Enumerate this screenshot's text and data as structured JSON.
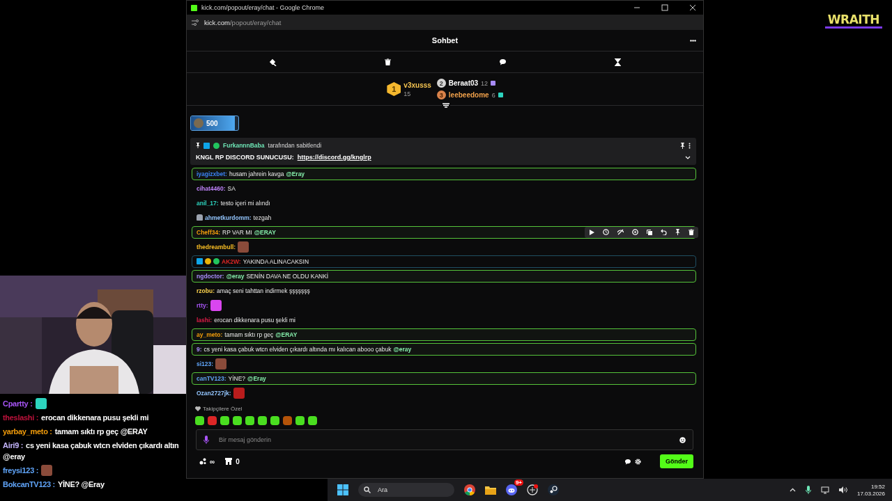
{
  "logo": {
    "text": "WRAITH"
  },
  "browser": {
    "title": "kick.com/popout/eray/chat - Google Chrome",
    "url_host": "kick.com",
    "url_path": "/popout/eray/chat"
  },
  "chat_header": {
    "title": "Sohbet"
  },
  "leaderboard": [
    {
      "rank": "1",
      "name": "v3xusss",
      "count": "15",
      "color": "#f5c451"
    },
    {
      "rank": "2",
      "name": "Beraat03",
      "count": "12",
      "color": "#ffffff"
    },
    {
      "rank": "3",
      "name": "leebeedome",
      "count": "6",
      "color": "#f0a14b"
    }
  ],
  "goal": {
    "amount": "500",
    "level": 0.93
  },
  "pinned": {
    "user": "FurkannnBaba",
    "note": "tarafından sabitlendi",
    "text": "KNGL RP DISCORD SUNUCUSU:",
    "link": "https://discord.gg/knglrp"
  },
  "messages": [
    {
      "kind": "mention",
      "user": "iyagizxbet:",
      "color": "#3b82f6",
      "parts": [
        {
          "kind": "text",
          "text": "husam jahrein kavga"
        },
        {
          "kind": "mention",
          "text": "@Eray"
        }
      ]
    },
    {
      "kind": "plain",
      "user": "cihat4460:",
      "color": "#c084fc",
      "parts": [
        {
          "kind": "text",
          "text": "SA"
        }
      ]
    },
    {
      "kind": "plain",
      "user": "anil_17:",
      "color": "#2dd4bf",
      "parts": [
        {
          "kind": "text",
          "text": "testo içeri mi alındı"
        }
      ]
    },
    {
      "kind": "plain",
      "user": "ahmetkurdomm:",
      "color": "#93c5fd",
      "badges": [
        {
          "kind": "helmet"
        }
      ],
      "parts": [
        {
          "kind": "text",
          "text": "tezgah"
        }
      ]
    },
    {
      "kind": "mention",
      "user": "Cheff34:",
      "color": "#f59e0b",
      "hovered": true,
      "parts": [
        {
          "kind": "text",
          "text": "RP VAR MI"
        },
        {
          "kind": "mention",
          "text": "@ERAY"
        }
      ]
    },
    {
      "kind": "plain",
      "user": "thedreambull:",
      "color": "#fbbf24",
      "parts": [
        {
          "kind": "emote",
          "color": "#8a4b3a"
        }
      ]
    },
    {
      "kind": "moderator",
      "user": "AK2W:",
      "color": "#dc2626",
      "badges": [
        {
          "kind": "moderator"
        },
        {
          "kind": "subscriber"
        },
        {
          "kind": "gifter"
        }
      ],
      "parts": [
        {
          "kind": "text",
          "text": "YAKINDA ALINACAKSIN"
        }
      ]
    },
    {
      "kind": "mention",
      "user": "ngdoctor:",
      "color": "#a78bfa",
      "parts": [
        {
          "kind": "mention",
          "text": "@eray"
        },
        {
          "kind": "text",
          "text": "SENİN DAVA NE OLDU KANKİ"
        }
      ]
    },
    {
      "kind": "plain",
      "user": "rzobu:",
      "color": "#fcd34d",
      "parts": [
        {
          "kind": "text",
          "text": "amaç seni tahttan indirmek şşşşşşş"
        }
      ]
    },
    {
      "kind": "plain",
      "user": "rtty:",
      "color": "#a855f7",
      "parts": [
        {
          "kind": "emote",
          "color": "#d946ef"
        }
      ]
    },
    {
      "kind": "plain",
      "user": "lashi:",
      "color": "#e11d48",
      "parts": [
        {
          "kind": "text",
          "text": "erocan dikkenara pusu şekli mi"
        }
      ]
    },
    {
      "kind": "mention",
      "user": "ay_meto:",
      "color": "#f59e0b",
      "parts": [
        {
          "kind": "text",
          "text": "tamam sıktı rp geç"
        },
        {
          "kind": "mention",
          "text": "@ERAY"
        }
      ]
    },
    {
      "kind": "mention",
      "user": "9:",
      "color": "#a78bfa",
      "parts": [
        {
          "kind": "text",
          "text": "cs yeni kasa çabuk wtcn elviden çıkardı altında mı kalıcan abooo çabuk"
        },
        {
          "kind": "mention",
          "text": "@eray"
        }
      ]
    },
    {
      "kind": "plain",
      "user": "si123:",
      "color": "#60a5fa",
      "parts": [
        {
          "kind": "emote",
          "color": "#8a4b3a"
        }
      ]
    },
    {
      "kind": "mention",
      "user": "canTV123:",
      "color": "#60a5fa",
      "parts": [
        {
          "kind": "text",
          "text": "YİNE?"
        },
        {
          "kind": "mention",
          "text": "@Eray"
        }
      ]
    },
    {
      "kind": "plain",
      "user": "Ozan2727jk:",
      "color": "#93c5fd",
      "parts": [
        {
          "kind": "emote",
          "color": "#b91c1c"
        }
      ]
    }
  ],
  "emote_menu": {
    "label": "Takipçilere Özel",
    "emotes": [
      {
        "color": "#4ade20"
      },
      {
        "color": "#dc2626"
      },
      {
        "color": "#4ade20"
      },
      {
        "color": "#4ade20"
      },
      {
        "color": "#4ade20"
      },
      {
        "color": "#4ade20"
      },
      {
        "color": "#4ade20"
      },
      {
        "color": "#b45309"
      },
      {
        "color": "#4ade20"
      },
      {
        "color": "#4ade20"
      }
    ]
  },
  "composer": {
    "placeholder": "Bir mesaj gönderin",
    "points": "∞",
    "store_count": "0",
    "send": "Gönder"
  },
  "overlay_chat": [
    {
      "user": "Cpartty :",
      "color": "#a855f7",
      "parts": [
        {
          "kind": "emote",
          "color": "#2dd4bf"
        }
      ]
    },
    {
      "user": "theslashi :",
      "color": "#be123c",
      "parts": [
        {
          "kind": "text",
          "text": "erocan dikkenara pusu şekli mi"
        }
      ]
    },
    {
      "user": "yarbay_meto :",
      "color": "#f59e0b",
      "parts": [
        {
          "kind": "text",
          "text": "tamam sıktı rp geç @ERAY"
        }
      ]
    },
    {
      "user": "Airi9 :",
      "color": "#c4b5fd",
      "parts": [
        {
          "kind": "text",
          "text": "cs yeni kasa çabuk wtcn elviden çıkardı altın"
        },
        {
          "kind": "text",
          "text": "@eray"
        }
      ]
    },
    {
      "user": "freysi123 :",
      "color": "#60a5fa",
      "parts": [
        {
          "kind": "emote",
          "color": "#8a4b3a"
        }
      ]
    },
    {
      "user": "BokcanTV123 :",
      "color": "#60a5fa",
      "parts": [
        {
          "kind": "text",
          "text": "YİNE? @Eray"
        }
      ]
    }
  ],
  "taskbar": {
    "search": "Ara",
    "discord_badge": "9+",
    "time": "19:52",
    "date": "17.03.2026"
  }
}
